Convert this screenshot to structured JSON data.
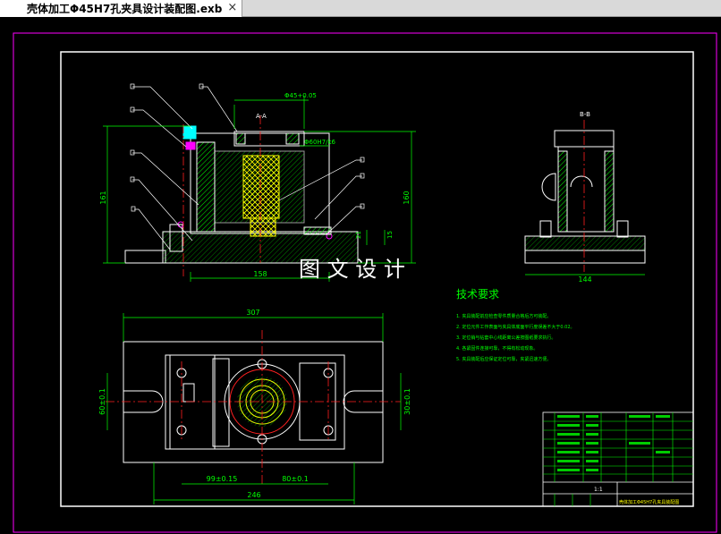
{
  "tab": {
    "title": "壳体加工Φ45H7孔夹具设计装配图.exb",
    "close_glyph": "×"
  },
  "watermark": "图 文 设 计",
  "sections": {
    "aa": "A-A",
    "bb": "B-B"
  },
  "dims": {
    "height_left": "161",
    "height_right": "160",
    "width_front": "158",
    "dia_top": "Φ45+0.05",
    "dia_mid": "Φ60H7/k6",
    "small_21": "21",
    "small_15": "15",
    "width_side": "144",
    "top_width": "307",
    "total_width": "246",
    "d1": "99±0.15",
    "d2": "80±0.1",
    "left_h": "60±0.1",
    "right_h": "30±0.1"
  },
  "tech": {
    "title": "技术要求",
    "items": [
      "1. 夹具装配前应检查零件质量合格后方可装配。",
      "2. 定位元件工作表面与夹具体底面平行度误差不大于0.02。",
      "3. 定位销与钻套中心线距离公差按图纸要求执行。",
      "4. 各紧固件连接可靠，不得有松动现象。",
      "5. 夹具装配后应保证定位可靠，夹紧迅速方便。"
    ]
  },
  "title_block": {
    "name_line": "壳体加工Φ45H7孔夹具装配图",
    "scale": "1:1"
  },
  "colors": {
    "line": "#ffffff",
    "green": "#00ff00",
    "red": "#ff2020",
    "magenta": "#ff00ff",
    "yellow": "#ffff00",
    "cyan": "#00ffff"
  }
}
